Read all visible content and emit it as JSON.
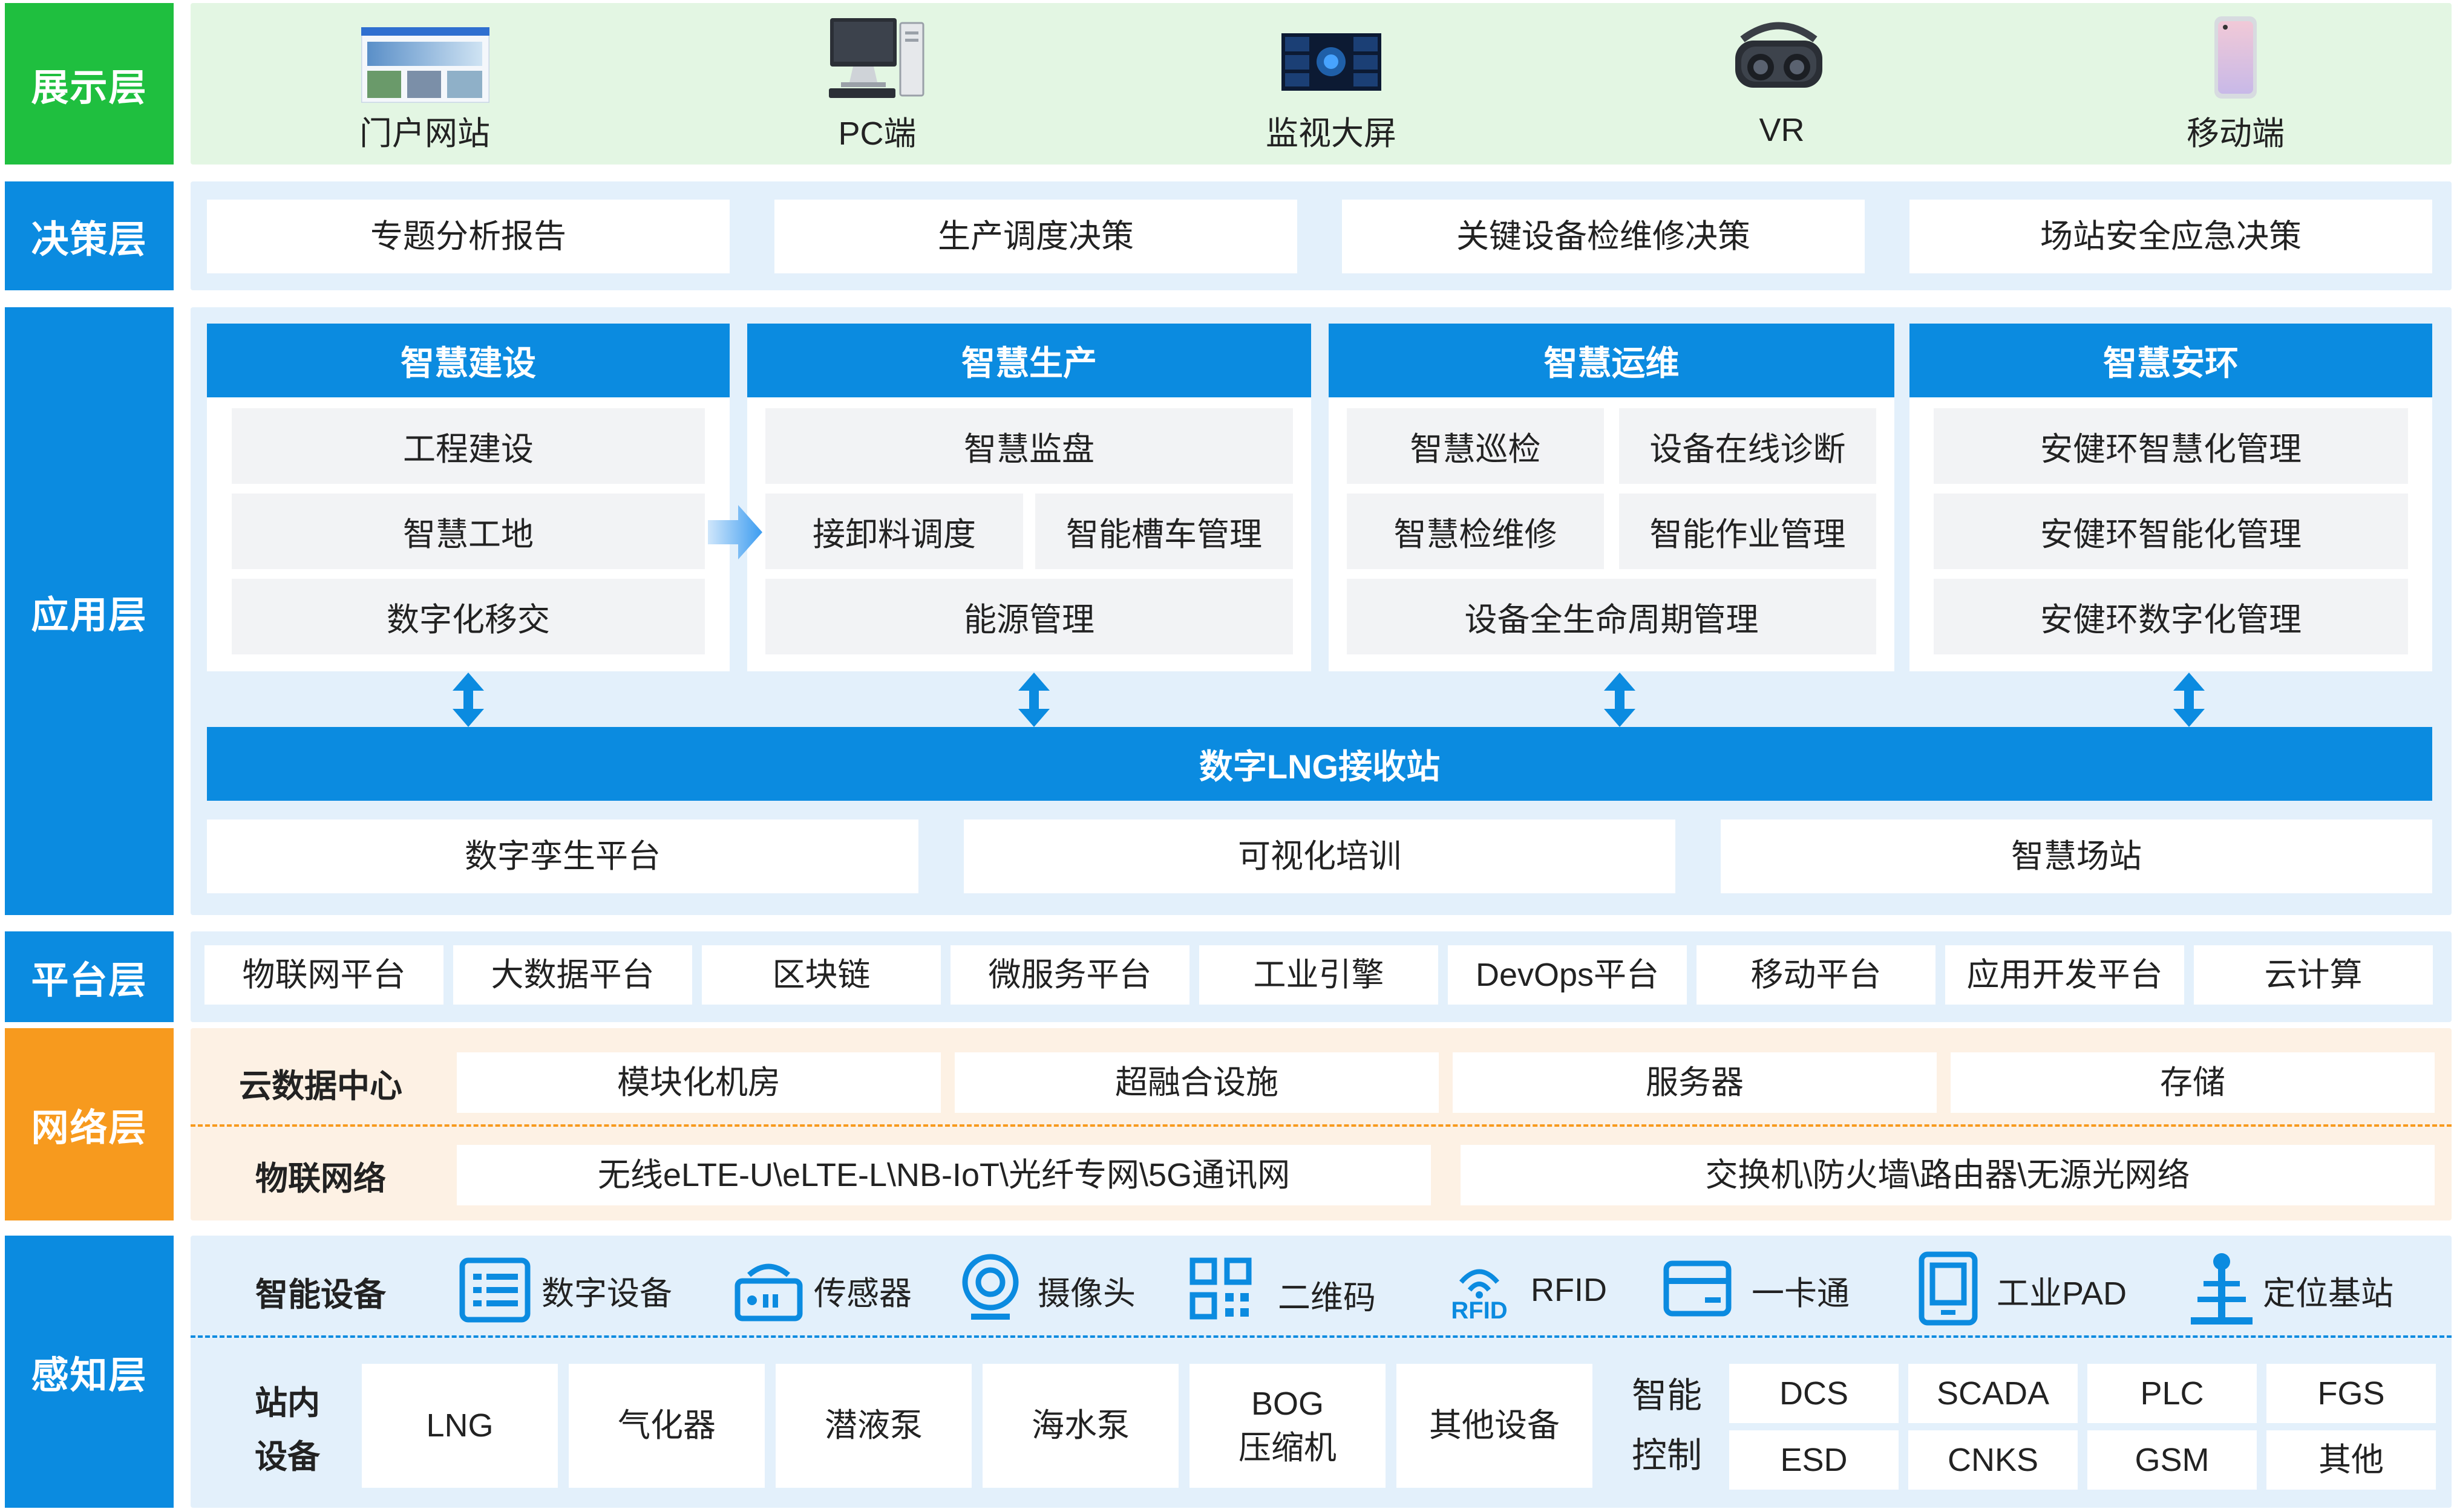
{
  "layers": {
    "display": "展示层",
    "decision": "决策层",
    "application": "应用层",
    "platform": "平台层",
    "network": "网络层",
    "perception": "感知层"
  },
  "colors": {
    "display_label": "#1fbf3f",
    "display_band": "#e3f6e3",
    "blue_label": "#0b8be0",
    "blue_band": "#e3f0fb",
    "orange_label": "#f79a1e",
    "orange_band": "#fdf1e4",
    "header_blue": "#0b8be0"
  },
  "display_items": [
    {
      "label": "门户网站",
      "icon": "web-portal-icon"
    },
    {
      "label": "PC端",
      "icon": "pc-icon"
    },
    {
      "label": "监视大屏",
      "icon": "monitor-screen-icon"
    },
    {
      "label": "VR",
      "icon": "vr-headset-icon"
    },
    {
      "label": "移动端",
      "icon": "mobile-phone-icon"
    }
  ],
  "decision_items": [
    "专题分析报告",
    "生产调度决策",
    "关键设备检维修决策",
    "场站安全应急决策"
  ],
  "application": {
    "columns": [
      {
        "title": "智慧建设",
        "items": [
          "工程建设",
          "智慧工地",
          "数字化移交"
        ]
      },
      {
        "title": "智慧生产",
        "items": [
          "智慧监盘",
          "接卸料调度",
          "智能槽车管理",
          "能源管理"
        ]
      },
      {
        "title": "智慧运维",
        "items": [
          "智慧巡检",
          "设备在线诊断",
          "智慧检维修",
          "智能作业管理",
          "设备全生命周期管理"
        ]
      },
      {
        "title": "智慧安环",
        "items": [
          "安健环智慧化管理",
          "安健环智能化管理",
          "安健环数字化管理"
        ]
      }
    ],
    "center_bar": "数字LNG接收站",
    "bottom": [
      "数字孪生平台",
      "可视化培训",
      "智慧场站"
    ]
  },
  "platform_items": [
    "物联网平台",
    "大数据平台",
    "区块链",
    "微服务平台",
    "工业引擎",
    "DevOps平台",
    "移动平台",
    "应用开发平台",
    "云计算"
  ],
  "network": {
    "cloud_label": "云数据中心",
    "cloud_items": [
      "模块化机房",
      "超融合设施",
      "服务器",
      "存储"
    ],
    "iot_label": "物联网络",
    "iot_items": [
      "无线eLTE-U\\eLTE-L\\NB-IoT\\光纤专网\\5G通讯网",
      "交换机\\防火墙\\路由器\\无源光网络"
    ]
  },
  "perception": {
    "smart_label": "智能设备",
    "smart_items": [
      {
        "label": "数字设备",
        "icon": "digital-device-icon"
      },
      {
        "label": "传感器",
        "icon": "sensor-icon"
      },
      {
        "label": "摄像头",
        "icon": "camera-icon"
      },
      {
        "label": "二维码",
        "icon": "qr-code-icon"
      },
      {
        "label": "RFID",
        "icon": "rfid-icon",
        "icon_text": "RFID"
      },
      {
        "label": "一卡通",
        "icon": "card-icon"
      },
      {
        "label": "工业PAD",
        "icon": "tablet-icon"
      },
      {
        "label": "定位基站",
        "icon": "base-station-icon"
      }
    ],
    "station_label_1": "站内",
    "station_label_2": "设备",
    "station_items": [
      "LNG",
      "气化器",
      "潜液泵",
      "海水泵",
      "BOG",
      "压缩机",
      "其他设备"
    ],
    "control_label_1": "智能",
    "control_label_2": "控制",
    "control_items": [
      "DCS",
      "SCADA",
      "PLC",
      "FGS",
      "ESD",
      "CNKS",
      "GSM",
      "其他"
    ]
  }
}
